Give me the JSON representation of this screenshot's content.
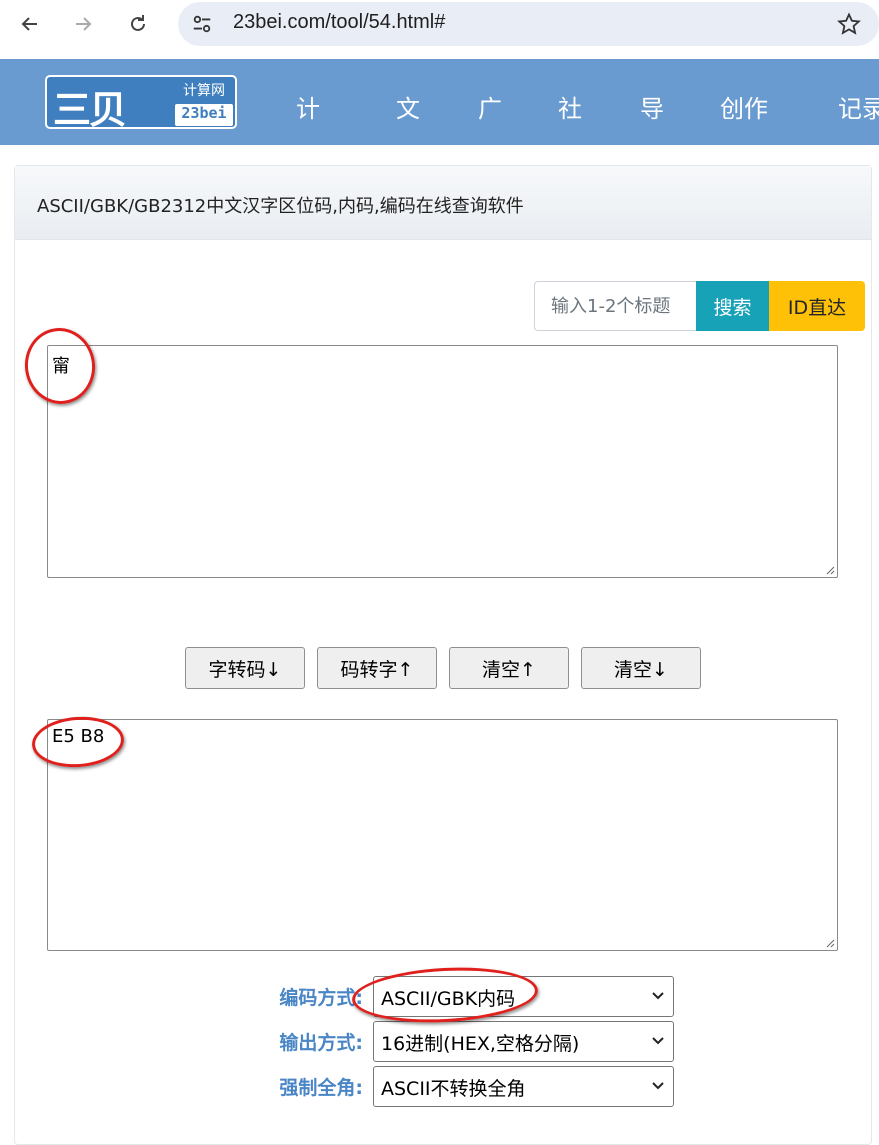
{
  "browser": {
    "url": "23bei.com/tool/54.html#"
  },
  "site": {
    "logo_main": "三贝",
    "logo_sub1": "计算网",
    "logo_sub2": "23bei",
    "menu": [
      "计",
      "文",
      "广",
      "社",
      "导",
      "创作",
      "记录"
    ]
  },
  "card": {
    "title": "ASCII/GBK/GB2312中文汉字区位码,内码,编码在线查询软件"
  },
  "search": {
    "placeholder": "输入1-2个标题",
    "search_label": "搜索",
    "id_label": "ID直达"
  },
  "input_text": "甯",
  "output_text": "E5 B8",
  "actions": {
    "char_to_code": "字转码↓",
    "code_to_char": "码转字↑",
    "clear_up": "清空↑",
    "clear_down": "清空↓"
  },
  "options": {
    "encoding_label": "编码方式:",
    "encoding_value": "ASCII/GBK内码",
    "output_label": "输出方式:",
    "output_value": "16进制(HEX,空格分隔)",
    "fullwidth_label": "强制全角:",
    "fullwidth_value": "ASCII不转换全角"
  },
  "colors": {
    "header_bg": "#6a9bd0",
    "search_btn": "#17a2b8",
    "id_btn": "#ffc107",
    "label_blue": "#4a86c5",
    "annotation_red": "#e0201c"
  }
}
